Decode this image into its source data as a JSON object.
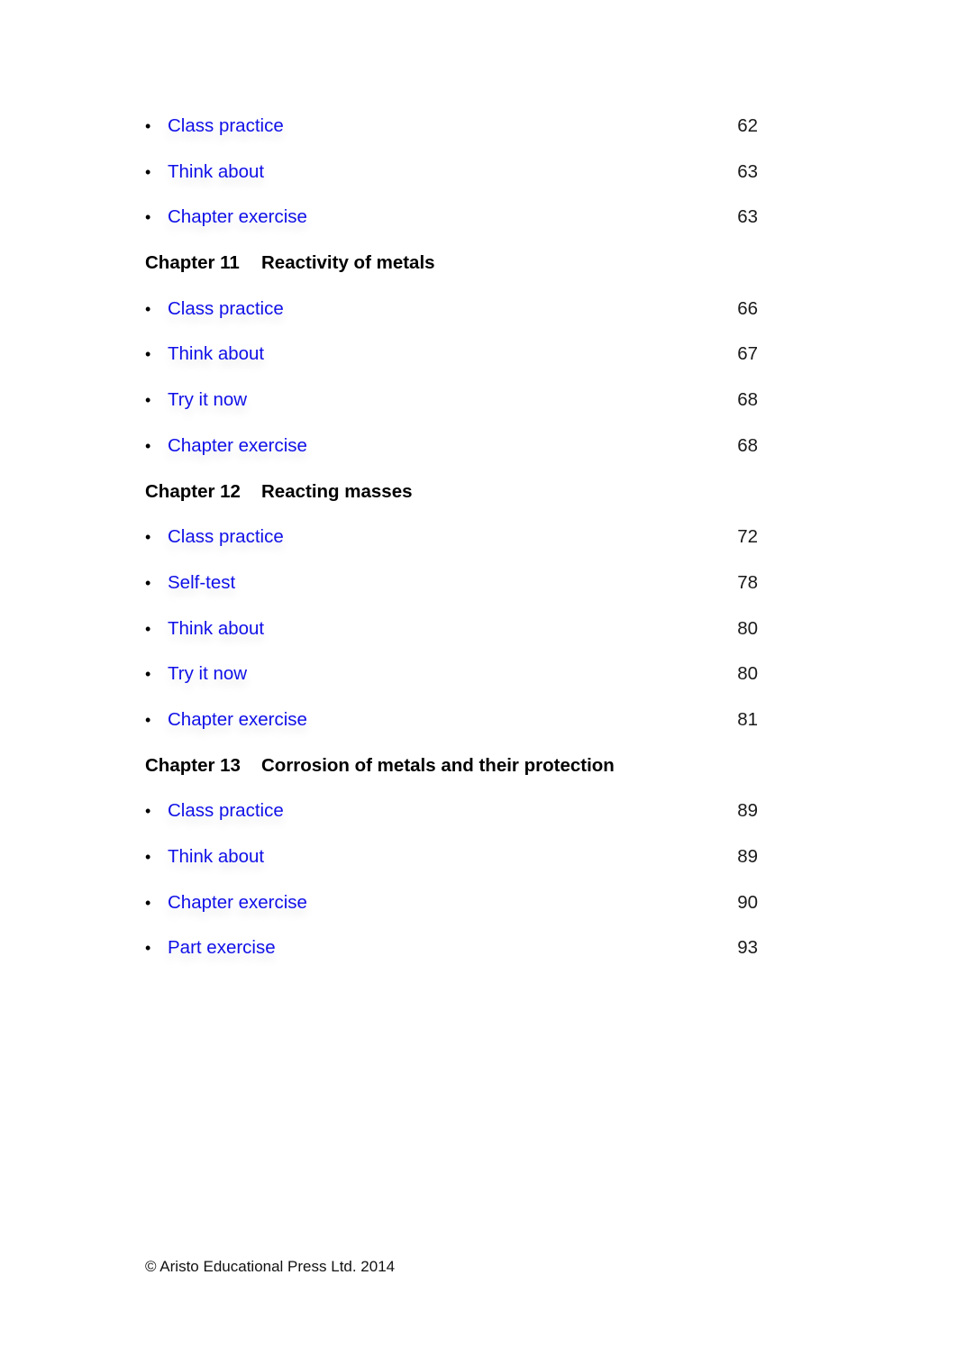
{
  "toc": [
    {
      "type": "entry",
      "label": "Class practice",
      "page": "62"
    },
    {
      "type": "entry",
      "label": "Think about",
      "page": "63"
    },
    {
      "type": "entry",
      "label": "Chapter exercise",
      "page": "63"
    },
    {
      "type": "heading",
      "chapter": "Chapter 11",
      "title": "Reactivity of metals"
    },
    {
      "type": "entry",
      "label": "Class practice",
      "page": "66"
    },
    {
      "type": "entry",
      "label": "Think about",
      "page": "67"
    },
    {
      "type": "entry",
      "label": "Try it now",
      "page": "68"
    },
    {
      "type": "entry",
      "label": "Chapter exercise",
      "page": "68"
    },
    {
      "type": "heading",
      "chapter": "Chapter 12",
      "title": "Reacting masses"
    },
    {
      "type": "entry",
      "label": "Class practice",
      "page": "72"
    },
    {
      "type": "entry",
      "label": "Self-test",
      "page": "78"
    },
    {
      "type": "entry",
      "label": "Think about",
      "page": "80"
    },
    {
      "type": "entry",
      "label": "Try it now",
      "page": "80"
    },
    {
      "type": "entry",
      "label": "Chapter exercise",
      "page": "81"
    },
    {
      "type": "heading",
      "chapter": "Chapter 13",
      "title": "Corrosion of metals and their protection"
    },
    {
      "type": "entry",
      "label": "Class practice",
      "page": "89"
    },
    {
      "type": "entry",
      "label": "Think about",
      "page": "89"
    },
    {
      "type": "entry",
      "label": "Chapter exercise",
      "page": "90"
    },
    {
      "type": "entry",
      "label": "Part exercise",
      "page": "93"
    }
  ],
  "bullet_glyph": "•",
  "footer": {
    "copyright": "© Aristo Educational Press Ltd. 2014"
  },
  "colors": {
    "link": "#1010e8",
    "text": "#000000"
  }
}
